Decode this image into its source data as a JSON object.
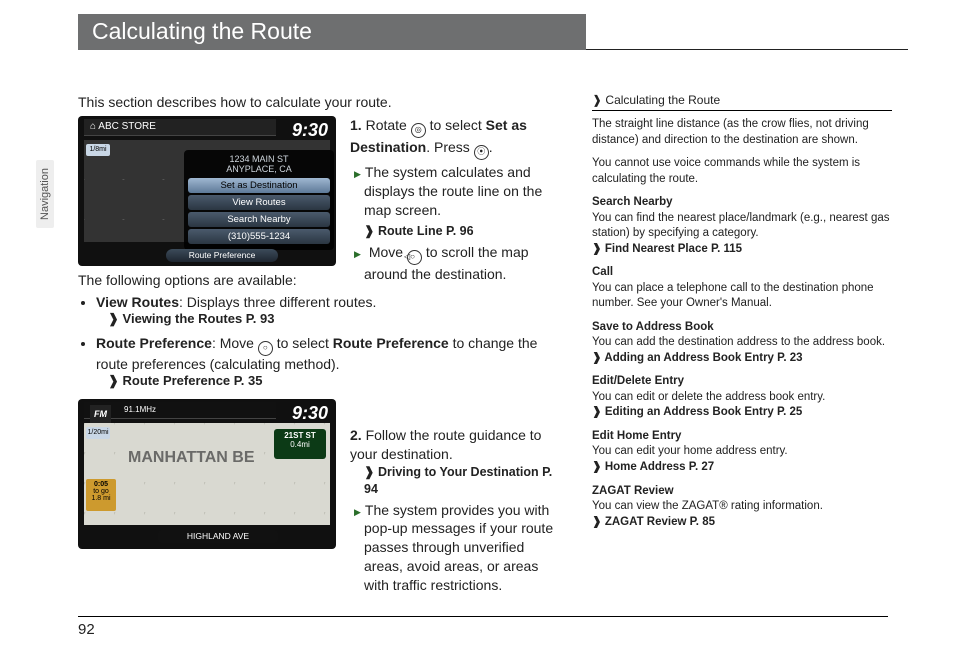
{
  "page_number": "92",
  "sidetab": "Navigation",
  "title": "Calculating the Route",
  "intro": "This section describes how to calculate your route.",
  "options_intro": "The following options are available:",
  "options": {
    "view_routes": {
      "name": "View Routes",
      "desc": ": Displays three different routes.",
      "xref": "Viewing the Routes P. 93"
    },
    "route_pref": {
      "name": "Route Preference",
      "desc_pre": ": Move ",
      "desc_post": " to select ",
      "bold2": "Route Preference",
      "desc_tail": " to change the route preferences (calculating method).",
      "xref": "Route Preference P. 35"
    }
  },
  "steps": {
    "s1": {
      "num": "1.",
      "text_pre": "Rotate ",
      "text_mid": " to select ",
      "bold1": "Set as Destination",
      "text_post": ". Press ",
      "text_end": ".",
      "sub1": "The system calculates and displays the route line on the map screen.",
      "xref1": "Route Line P. 96",
      "sub2_pre": "Move ",
      "sub2_post": " to scroll the map around the destination."
    },
    "s2": {
      "num": "2.",
      "text": "Follow the route guidance to your destination.",
      "xref1": "Driving to Your Destination P. 94",
      "sub1": "The system provides you with pop-up messages if your route passes through unverified areas, avoid areas, or areas with traffic restrictions."
    }
  },
  "screenshot1": {
    "clock": "9:30",
    "top_icon": "⌂",
    "top_label": "ABC STORE",
    "addr1": "1234 MAIN ST",
    "addr2": "ANYPLACE, CA",
    "menu": {
      "item1": "Set as Destination",
      "item2": "View Routes",
      "item3": "Search Nearby",
      "item4": "(310)555-1234"
    },
    "route_pref_btn": "Route Preference",
    "scale": "1/8mi"
  },
  "screenshot2": {
    "clock": "9:30",
    "fm": "FM",
    "freq": "91.1MHz",
    "bigtext": "MANHATTAN BE",
    "eta_time": "0:05",
    "eta_label": "to go",
    "eta_dist": "1.8 mi",
    "turn_street": "21ST ST",
    "turn_dist": "0.4mi",
    "banner": "HIGHLAND AVE",
    "scale": "1/20mi"
  },
  "sidebar": {
    "title_icon": "❱",
    "title": "Calculating the Route",
    "p1": "The straight line distance (as the crow flies, not driving distance) and direction to the destination are shown.",
    "p2": "You cannot use voice commands while the system is calculating the route.",
    "search_nearby": {
      "head": "Search Nearby",
      "body": "You can find the nearest place/landmark (e.g., nearest gas station) by specifying a category.",
      "xref": "Find Nearest Place P. 115"
    },
    "call": {
      "head": "Call",
      "body": "You can place a telephone call to the destination phone number. See your Owner's Manual."
    },
    "save": {
      "head": "Save to Address Book",
      "body": "You can add the destination address to the address book.",
      "xref": "Adding an Address Book Entry P. 23"
    },
    "edit": {
      "head": "Edit/Delete Entry",
      "body": "You can edit or delete the address book entry.",
      "xref": "Editing an Address Book Entry P. 25"
    },
    "home": {
      "head": "Edit Home Entry",
      "body": "You can edit your home address entry.",
      "xref": "Home Address P. 27"
    },
    "zagat": {
      "head": "ZAGAT Review",
      "body": "You can view the ZAGAT® rating information.",
      "xref": "ZAGAT Review P. 85"
    }
  }
}
